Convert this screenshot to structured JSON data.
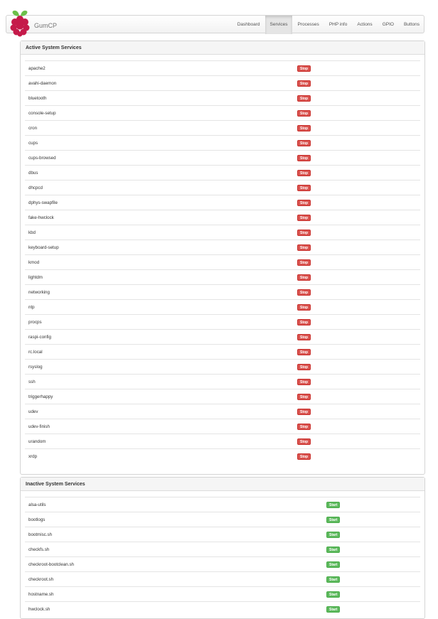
{
  "brand": "GumCP",
  "nav": [
    "Dashboard",
    "Services",
    "Processes",
    "PHP info",
    "Actions",
    "GPIO",
    "Buttons"
  ],
  "active": {
    "title": "Active System Services",
    "button_label": "Stop",
    "services": [
      "apache2",
      "avahi-daemon",
      "bluetooth",
      "console-setup",
      "cron",
      "cups",
      "cups-browsed",
      "dbus",
      "dhcpcd",
      "dphys-swapfile",
      "fake-hwclock",
      "kbd",
      "keyboard-setup",
      "kmod",
      "lightdm",
      "networking",
      "ntp",
      "procps",
      "raspi-config",
      "rc.local",
      "rsyslog",
      "ssh",
      "triggerhappy",
      "udev",
      "udev-finish",
      "urandom",
      "xrdp"
    ]
  },
  "inactive": {
    "title": "Inactive System Services",
    "button_label": "Start",
    "services": [
      "alsa-utils",
      "bootlogs",
      "bootmisc.sh",
      "checkfs.sh",
      "checkroot-bootclean.sh",
      "checkroot.sh",
      "hostname.sh",
      "hwclock.sh"
    ]
  },
  "colors": {
    "stop": "#d9534f",
    "start": "#5cb85c",
    "navbar": "#f2f2f2"
  }
}
